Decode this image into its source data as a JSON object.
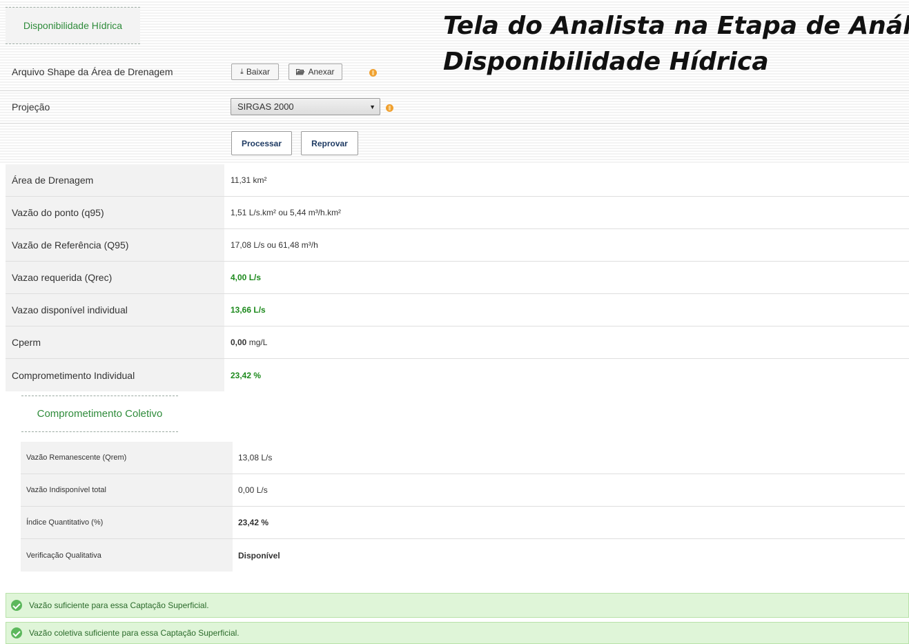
{
  "section_title": "Disponibilidade Hídrica",
  "overlay_title": {
    "line1": "Tela do Analista na Etapa de Análi",
    "line2": "Disponibilidade Hídrica"
  },
  "shape_row": {
    "label": "Arquivo Shape da Área de Drenagem",
    "download_label": "Baixar",
    "attach_label": "Anexar"
  },
  "projection_row": {
    "label": "Projeção",
    "selected": "SIRGAS 2000"
  },
  "actions": {
    "process_label": "Processar",
    "reject_label": "Reprovar"
  },
  "results": [
    {
      "label": "Área de Drenagem",
      "value": "11,31 km²"
    },
    {
      "label": "Vazão do ponto (q95)",
      "value": "1,51 L/s.km² ou 5,44 m³/h.km²"
    },
    {
      "label": "Vazão de Referência (Q95)",
      "value": "17,08 L/s ou 61,48 m³/h"
    },
    {
      "label": "Vazao requerida (Qrec)",
      "value": "4,00 L/s"
    },
    {
      "label": "Vazao disponível individual",
      "value": "13,66 L/s"
    },
    {
      "label": "Cperm",
      "value_bold": "0,00",
      "value_unit": "mg/L"
    },
    {
      "label": "Comprometimento Individual",
      "value": "23,42 %"
    }
  ],
  "collective": {
    "title": "Comprometimento Coletivo",
    "rows": [
      {
        "label": "Vazão Remanescente (Qrem)",
        "value": "13,08 L/s"
      },
      {
        "label": "Vazão Indisponível total",
        "value": "0,00 L/s"
      },
      {
        "label": "Índice Quantitativo (%)",
        "value": "23,42 %"
      },
      {
        "label": "Verificação Qualitativa",
        "value": "Disponível"
      }
    ]
  },
  "alerts": [
    {
      "text": "Vazão suficiente para essa Captação Superficial."
    },
    {
      "text": "Vazão coletiva suficiente para essa Captação Superficial."
    }
  ],
  "colors": {
    "accent_green": "#2e8b3a",
    "value_green": "#1d8a1d",
    "warning": "#f0a030",
    "alert_bg": "#dff5d8"
  },
  "icons": [
    "download-icon",
    "folder-open-icon",
    "warning-icon",
    "check-circle-icon"
  ]
}
